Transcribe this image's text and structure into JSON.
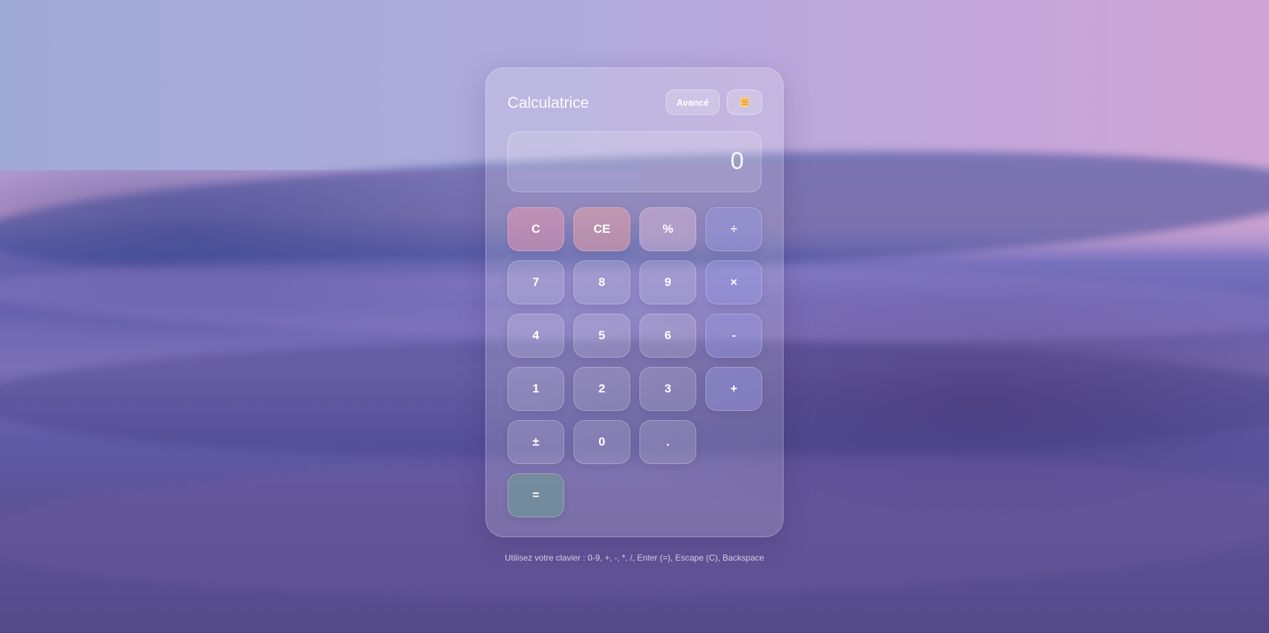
{
  "app": {
    "title": "Calculatrice"
  },
  "toolbar": {
    "advanced_label": "Avancé",
    "history_icon": "notepad-icon"
  },
  "display": {
    "value": "0"
  },
  "keypad": {
    "clear": "C",
    "clear_entry": "CE",
    "percent": "%",
    "divide": "÷",
    "seven": "7",
    "eight": "8",
    "nine": "9",
    "multiply": "×",
    "four": "4",
    "five": "5",
    "six": "6",
    "minus": "-",
    "one": "1",
    "two": "2",
    "three": "3",
    "plus": "+",
    "negate": "±",
    "zero": "0",
    "decimal": ".",
    "equals": "="
  },
  "hint": {
    "text": "Utilisez votre clavier : 0-9, +, -, *, /, Enter (=), Escape (C), Backspace"
  },
  "colors": {
    "clear_key": "#e196af",
    "operator_key": "#9696e1",
    "equals_key": "#6ea096"
  }
}
